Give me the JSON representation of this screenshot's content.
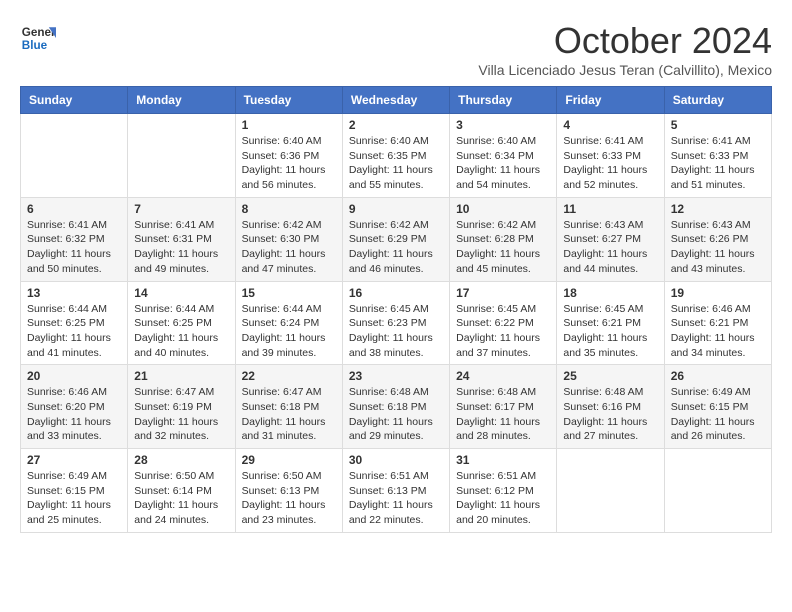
{
  "header": {
    "logo_general": "General",
    "logo_blue": "Blue",
    "month_title": "October 2024",
    "subtitle": "Villa Licenciado Jesus Teran (Calvillito), Mexico"
  },
  "weekdays": [
    "Sunday",
    "Monday",
    "Tuesday",
    "Wednesday",
    "Thursday",
    "Friday",
    "Saturday"
  ],
  "weeks": [
    [
      {
        "day": "",
        "sunrise": "",
        "sunset": "",
        "daylight": ""
      },
      {
        "day": "",
        "sunrise": "",
        "sunset": "",
        "daylight": ""
      },
      {
        "day": "1",
        "sunrise": "Sunrise: 6:40 AM",
        "sunset": "Sunset: 6:36 PM",
        "daylight": "Daylight: 11 hours and 56 minutes."
      },
      {
        "day": "2",
        "sunrise": "Sunrise: 6:40 AM",
        "sunset": "Sunset: 6:35 PM",
        "daylight": "Daylight: 11 hours and 55 minutes."
      },
      {
        "day": "3",
        "sunrise": "Sunrise: 6:40 AM",
        "sunset": "Sunset: 6:34 PM",
        "daylight": "Daylight: 11 hours and 54 minutes."
      },
      {
        "day": "4",
        "sunrise": "Sunrise: 6:41 AM",
        "sunset": "Sunset: 6:33 PM",
        "daylight": "Daylight: 11 hours and 52 minutes."
      },
      {
        "day": "5",
        "sunrise": "Sunrise: 6:41 AM",
        "sunset": "Sunset: 6:33 PM",
        "daylight": "Daylight: 11 hours and 51 minutes."
      }
    ],
    [
      {
        "day": "6",
        "sunrise": "Sunrise: 6:41 AM",
        "sunset": "Sunset: 6:32 PM",
        "daylight": "Daylight: 11 hours and 50 minutes."
      },
      {
        "day": "7",
        "sunrise": "Sunrise: 6:41 AM",
        "sunset": "Sunset: 6:31 PM",
        "daylight": "Daylight: 11 hours and 49 minutes."
      },
      {
        "day": "8",
        "sunrise": "Sunrise: 6:42 AM",
        "sunset": "Sunset: 6:30 PM",
        "daylight": "Daylight: 11 hours and 47 minutes."
      },
      {
        "day": "9",
        "sunrise": "Sunrise: 6:42 AM",
        "sunset": "Sunset: 6:29 PM",
        "daylight": "Daylight: 11 hours and 46 minutes."
      },
      {
        "day": "10",
        "sunrise": "Sunrise: 6:42 AM",
        "sunset": "Sunset: 6:28 PM",
        "daylight": "Daylight: 11 hours and 45 minutes."
      },
      {
        "day": "11",
        "sunrise": "Sunrise: 6:43 AM",
        "sunset": "Sunset: 6:27 PM",
        "daylight": "Daylight: 11 hours and 44 minutes."
      },
      {
        "day": "12",
        "sunrise": "Sunrise: 6:43 AM",
        "sunset": "Sunset: 6:26 PM",
        "daylight": "Daylight: 11 hours and 43 minutes."
      }
    ],
    [
      {
        "day": "13",
        "sunrise": "Sunrise: 6:44 AM",
        "sunset": "Sunset: 6:25 PM",
        "daylight": "Daylight: 11 hours and 41 minutes."
      },
      {
        "day": "14",
        "sunrise": "Sunrise: 6:44 AM",
        "sunset": "Sunset: 6:25 PM",
        "daylight": "Daylight: 11 hours and 40 minutes."
      },
      {
        "day": "15",
        "sunrise": "Sunrise: 6:44 AM",
        "sunset": "Sunset: 6:24 PM",
        "daylight": "Daylight: 11 hours and 39 minutes."
      },
      {
        "day": "16",
        "sunrise": "Sunrise: 6:45 AM",
        "sunset": "Sunset: 6:23 PM",
        "daylight": "Daylight: 11 hours and 38 minutes."
      },
      {
        "day": "17",
        "sunrise": "Sunrise: 6:45 AM",
        "sunset": "Sunset: 6:22 PM",
        "daylight": "Daylight: 11 hours and 37 minutes."
      },
      {
        "day": "18",
        "sunrise": "Sunrise: 6:45 AM",
        "sunset": "Sunset: 6:21 PM",
        "daylight": "Daylight: 11 hours and 35 minutes."
      },
      {
        "day": "19",
        "sunrise": "Sunrise: 6:46 AM",
        "sunset": "Sunset: 6:21 PM",
        "daylight": "Daylight: 11 hours and 34 minutes."
      }
    ],
    [
      {
        "day": "20",
        "sunrise": "Sunrise: 6:46 AM",
        "sunset": "Sunset: 6:20 PM",
        "daylight": "Daylight: 11 hours and 33 minutes."
      },
      {
        "day": "21",
        "sunrise": "Sunrise: 6:47 AM",
        "sunset": "Sunset: 6:19 PM",
        "daylight": "Daylight: 11 hours and 32 minutes."
      },
      {
        "day": "22",
        "sunrise": "Sunrise: 6:47 AM",
        "sunset": "Sunset: 6:18 PM",
        "daylight": "Daylight: 11 hours and 31 minutes."
      },
      {
        "day": "23",
        "sunrise": "Sunrise: 6:48 AM",
        "sunset": "Sunset: 6:18 PM",
        "daylight": "Daylight: 11 hours and 29 minutes."
      },
      {
        "day": "24",
        "sunrise": "Sunrise: 6:48 AM",
        "sunset": "Sunset: 6:17 PM",
        "daylight": "Daylight: 11 hours and 28 minutes."
      },
      {
        "day": "25",
        "sunrise": "Sunrise: 6:48 AM",
        "sunset": "Sunset: 6:16 PM",
        "daylight": "Daylight: 11 hours and 27 minutes."
      },
      {
        "day": "26",
        "sunrise": "Sunrise: 6:49 AM",
        "sunset": "Sunset: 6:15 PM",
        "daylight": "Daylight: 11 hours and 26 minutes."
      }
    ],
    [
      {
        "day": "27",
        "sunrise": "Sunrise: 6:49 AM",
        "sunset": "Sunset: 6:15 PM",
        "daylight": "Daylight: 11 hours and 25 minutes."
      },
      {
        "day": "28",
        "sunrise": "Sunrise: 6:50 AM",
        "sunset": "Sunset: 6:14 PM",
        "daylight": "Daylight: 11 hours and 24 minutes."
      },
      {
        "day": "29",
        "sunrise": "Sunrise: 6:50 AM",
        "sunset": "Sunset: 6:13 PM",
        "daylight": "Daylight: 11 hours and 23 minutes."
      },
      {
        "day": "30",
        "sunrise": "Sunrise: 6:51 AM",
        "sunset": "Sunset: 6:13 PM",
        "daylight": "Daylight: 11 hours and 22 minutes."
      },
      {
        "day": "31",
        "sunrise": "Sunrise: 6:51 AM",
        "sunset": "Sunset: 6:12 PM",
        "daylight": "Daylight: 11 hours and 20 minutes."
      },
      {
        "day": "",
        "sunrise": "",
        "sunset": "",
        "daylight": ""
      },
      {
        "day": "",
        "sunrise": "",
        "sunset": "",
        "daylight": ""
      }
    ]
  ]
}
